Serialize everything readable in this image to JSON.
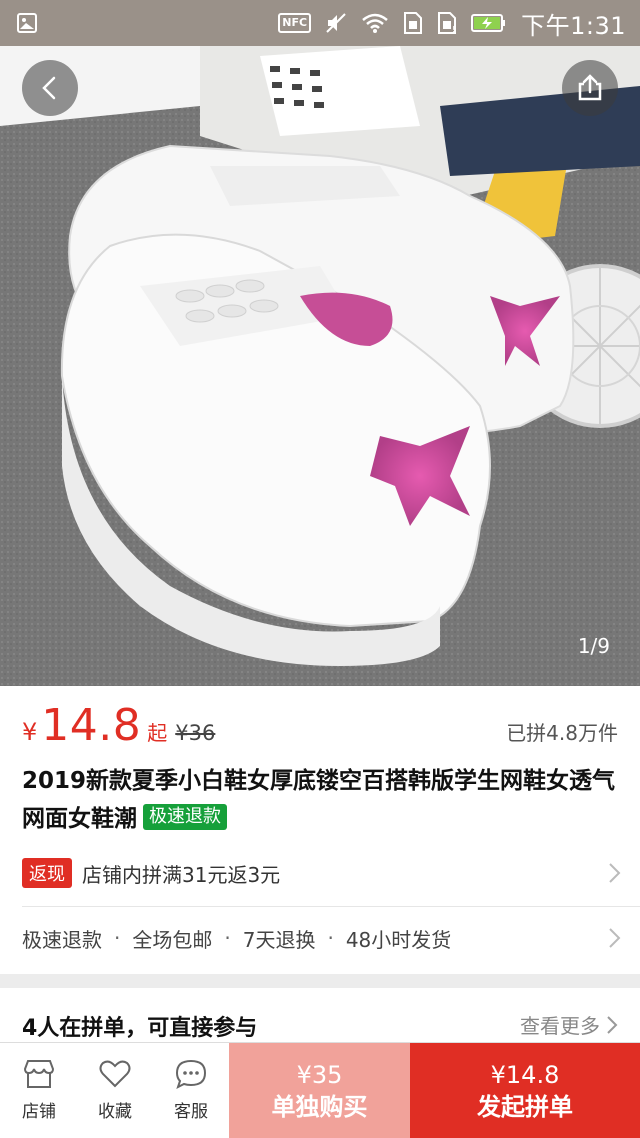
{
  "status_bar": {
    "nfc": "NFC",
    "time": "下午1:31",
    "icons": [
      "gallery-icon",
      "nfc-icon",
      "mute-icon",
      "wifi-icon",
      "sim1-icon",
      "sim2-icon",
      "battery-charging-icon"
    ]
  },
  "gallery": {
    "page_indicator": "1/9"
  },
  "product": {
    "currency": "¥",
    "price": "14.8",
    "price_suffix": "起",
    "original_price": "¥36",
    "sold": "已拼4.8万件",
    "title": "2019新款夏季小白鞋女厚底镂空百搭韩版学生网鞋女透气网面女鞋潮",
    "refund_tag": "极速退款",
    "cashback_badge": "返现",
    "cashback_text": "店铺内拼满31元返3元"
  },
  "services": [
    "极速退款",
    "全场包邮",
    "7天退换",
    "48小时发货"
  ],
  "group": {
    "title": "4人在拼单，可直接参与",
    "more": "查看更多"
  },
  "bottom_bar": {
    "tabs": [
      {
        "label": "店铺",
        "icon": "store-icon"
      },
      {
        "label": "收藏",
        "icon": "heart-icon"
      },
      {
        "label": "客服",
        "icon": "chat-icon"
      }
    ],
    "solo_price": "¥35",
    "solo_label": "单独购买",
    "group_price": "¥14.8",
    "group_label": "发起拼单"
  },
  "colors": {
    "accent_red": "#e02e24",
    "solo_pink": "#f1a29a",
    "refund_green": "#16a03a",
    "status_bar": "#9a9189"
  }
}
